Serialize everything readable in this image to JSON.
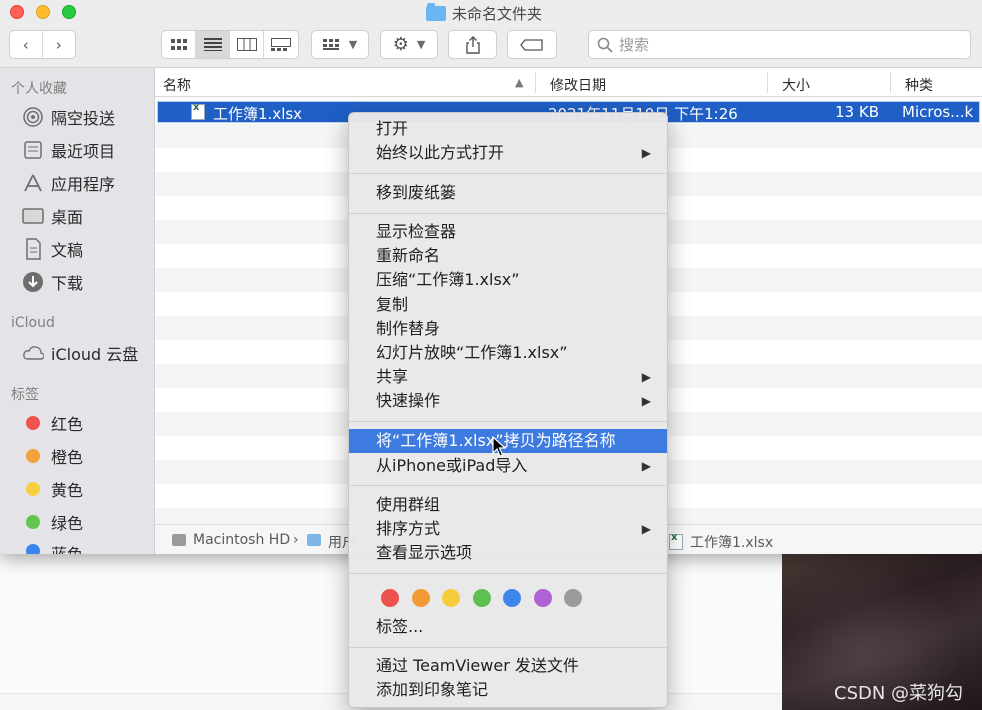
{
  "window": {
    "title": "未命名文件夹",
    "search_placeholder": "搜索"
  },
  "sidebar": {
    "favorites_header": "个人收藏",
    "favorites": [
      {
        "label": "隔空投送",
        "icon": "airdrop-icon"
      },
      {
        "label": "最近项目",
        "icon": "recents-icon"
      },
      {
        "label": "应用程序",
        "icon": "applications-icon"
      },
      {
        "label": "桌面",
        "icon": "desktop-icon"
      },
      {
        "label": "文稿",
        "icon": "documents-icon"
      },
      {
        "label": "下载",
        "icon": "downloads-icon"
      }
    ],
    "icloud_header": "iCloud",
    "icloud_drive": "iCloud 云盘",
    "tags_header": "标签",
    "tags": [
      {
        "label": "红色",
        "color": "#f0524f"
      },
      {
        "label": "橙色",
        "color": "#f3a13a"
      },
      {
        "label": "黄色",
        "color": "#f5cf3e"
      },
      {
        "label": "绿色",
        "color": "#5fc750"
      },
      {
        "label": "蓝色",
        "color": "#3a86f0"
      }
    ]
  },
  "list": {
    "columns": {
      "name": "名称",
      "modified": "修改日期",
      "size": "大小",
      "kind": "种类"
    },
    "selected_file": {
      "name": "工作簿1.xlsx",
      "modified": "2021年11月10日 下午1:26",
      "size": "13 KB",
      "kind": "Micros...k"
    }
  },
  "pathbar": {
    "disk": "Macintosh HD",
    "users": "用户",
    "file": "工作簿1.xlsx"
  },
  "context_menu": {
    "open": "打开",
    "open_with": "始终以此方式打开",
    "trash": "移到废纸篓",
    "inspector": "显示检查器",
    "rename": "重新命名",
    "compress": "压缩“工作簿1.xlsx”",
    "duplicate": "复制",
    "alias": "制作替身",
    "slideshow": "幻灯片放映“工作簿1.xlsx”",
    "share": "共享",
    "quick_actions": "快速操作",
    "copy_path": "将“工作簿1.xlsx”拷贝为路径名称",
    "import_iphone": "从iPhone或iPad导入",
    "use_groups": "使用群组",
    "sort_by": "排序方式",
    "view_options": "查看显示选项",
    "tag_colors": [
      "#ee524f",
      "#f39a37",
      "#f6cb3c",
      "#5ec050",
      "#3d86ee",
      "#ad62d6",
      "#9a9a9a"
    ],
    "tags": "标签...",
    "teamviewer": "通过 TeamViewer 发送文件",
    "evernote": "添加到印象笔记"
  },
  "watermark": "CSDN @菜狗勾"
}
